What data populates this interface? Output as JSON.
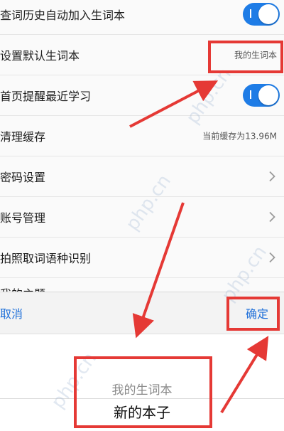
{
  "settings": {
    "rows": [
      {
        "label": "查词历史自动加入生词本",
        "type": "toggle",
        "on": true
      },
      {
        "label": "设置默认生词本",
        "type": "value",
        "value": "我的生词本"
      },
      {
        "label": "首页提醒最近学习",
        "type": "toggle",
        "on": true
      },
      {
        "label": "清理缓存",
        "type": "value",
        "value": "当前缓存为13.96M"
      },
      {
        "label": "密码设置",
        "type": "chevron"
      },
      {
        "label": "账号管理",
        "type": "chevron"
      },
      {
        "label": "拍照取词语种识别",
        "type": "chevron"
      }
    ],
    "partial_row_label": "我的主题"
  },
  "picker": {
    "cancel_label": "取消",
    "confirm_label": "确定",
    "options": [
      "我的生词本",
      "新的本子"
    ],
    "selected": "新的本子"
  },
  "watermark": "php.cn",
  "colors": {
    "annotation": "#e53935",
    "accent": "#1e7ce6"
  }
}
